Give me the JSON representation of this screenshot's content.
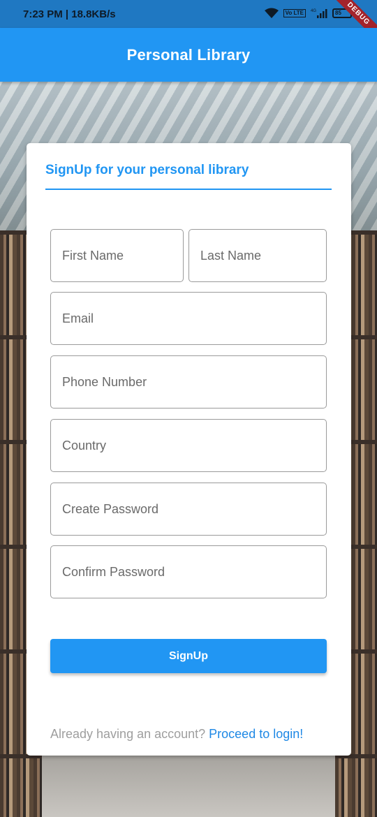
{
  "status_bar": {
    "time_speed": "7:23 PM | 18.8KB/s",
    "network_label": "4G",
    "volte_label": "Vo LTE",
    "battery_label": "85",
    "debug_banner": "DEBUG"
  },
  "app_bar": {
    "title": "Personal Library",
    "color": "#2196f3"
  },
  "form": {
    "heading": "SignUp for your personal library",
    "fields": {
      "first_name": {
        "placeholder": "First Name",
        "value": ""
      },
      "last_name": {
        "placeholder": "Last Name",
        "value": ""
      },
      "email": {
        "placeholder": "Email",
        "value": ""
      },
      "phone": {
        "placeholder": "Phone Number",
        "value": ""
      },
      "country": {
        "placeholder": "Country",
        "value": ""
      },
      "create_password": {
        "placeholder": "Create Password",
        "value": ""
      },
      "confirm_password": {
        "placeholder": "Confirm Password",
        "value": ""
      }
    },
    "submit_label": "SignUp",
    "login_prompt": "Already having an account? ",
    "login_link": "Proceed to login!"
  },
  "icons": [
    "wifi-icon",
    "volte-icon",
    "signal-icon",
    "battery-icon"
  ]
}
